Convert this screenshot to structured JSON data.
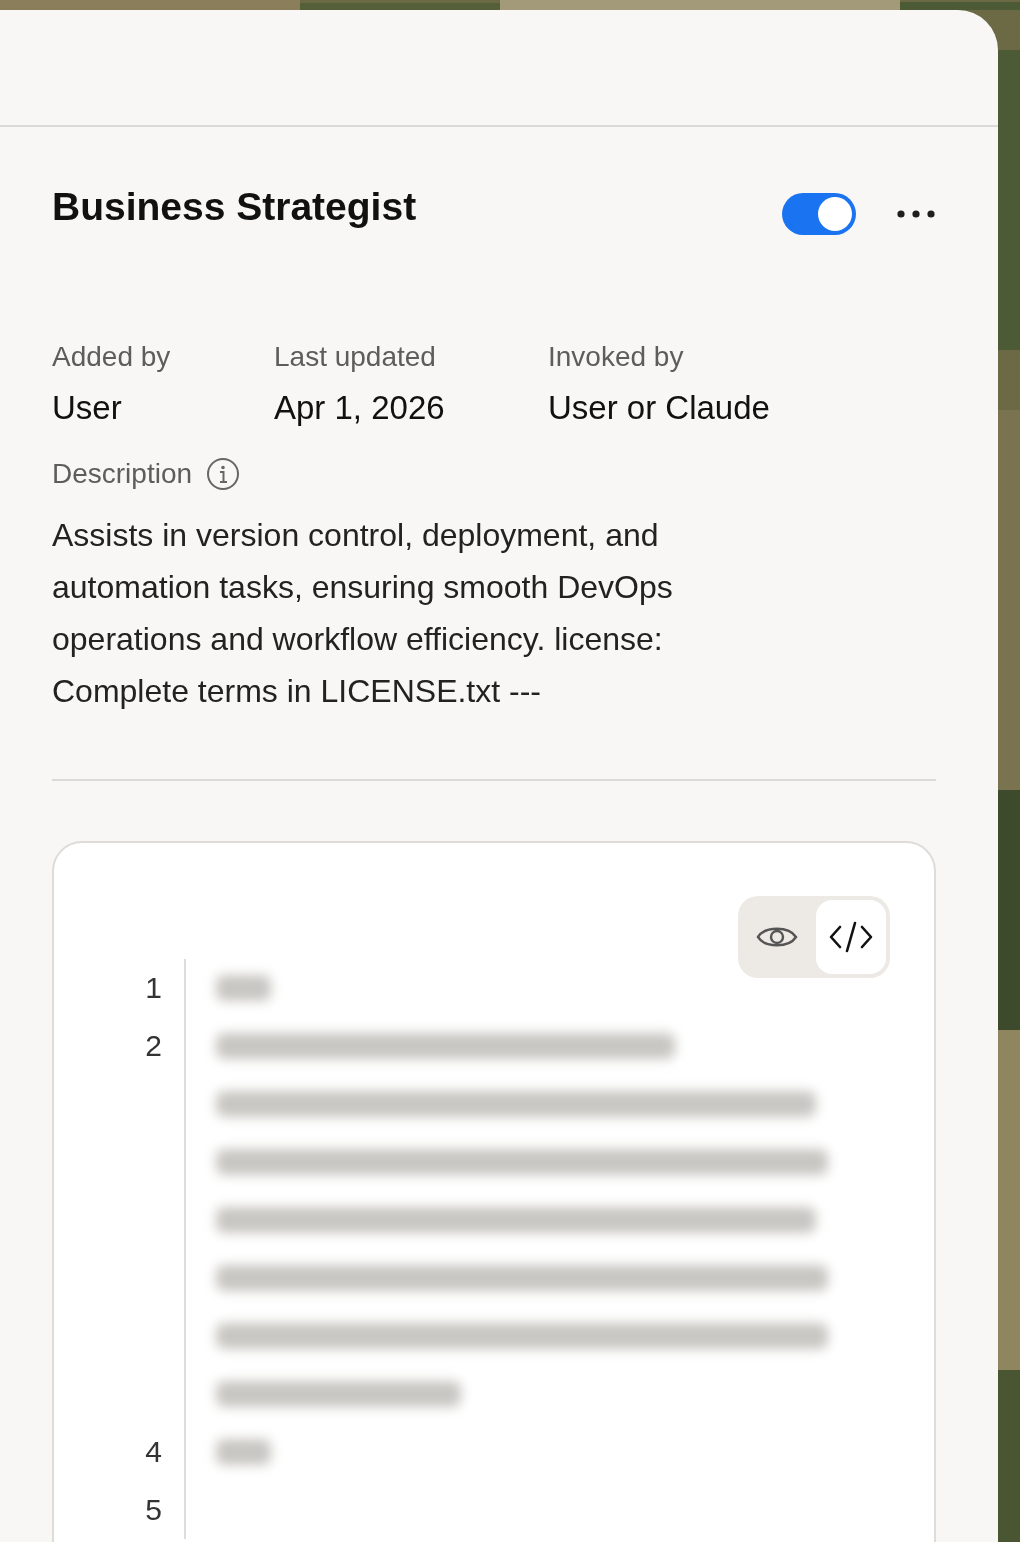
{
  "skill": {
    "title": "Business Strategist",
    "enabled": true
  },
  "meta": [
    {
      "label": "Added by",
      "value": "User"
    },
    {
      "label": "Last updated",
      "value": "Apr 1, 2026"
    },
    {
      "label": "Invoked by",
      "value": "User or Claude"
    }
  ],
  "description": {
    "label": "Description",
    "text": "Assists in version control, deployment, and automation tasks, ensuring smooth DevOps operations and workflow efficiency. license: Complete terms in LICENSE.txt ---"
  },
  "view_toggle": [
    {
      "kind": "preview",
      "selected": false
    },
    {
      "kind": "code",
      "selected": true
    }
  ],
  "code_lines": [
    {
      "number": "1",
      "kind": "short"
    },
    {
      "number": "2",
      "kind": "wrapped"
    },
    {
      "number": "4",
      "kind": "short"
    },
    {
      "number": "5",
      "kind": "empty"
    }
  ]
}
